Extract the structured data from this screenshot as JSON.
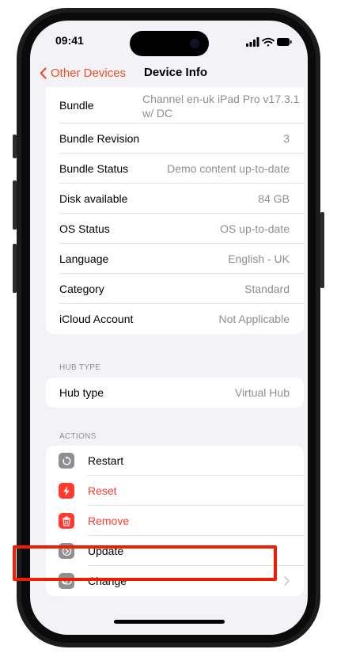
{
  "status": {
    "time": "09:41",
    "icons": [
      "signal-icon",
      "wifi-icon",
      "battery-icon"
    ]
  },
  "nav": {
    "back_label": "Other Devices",
    "title": "Device Info"
  },
  "info_rows": [
    {
      "label": "Bundle",
      "value": "Channel en-uk iPad Pro v17.3.1 w/ DC"
    },
    {
      "label": "Bundle Revision",
      "value": "3"
    },
    {
      "label": "Bundle Status",
      "value": "Demo content up-to-date"
    },
    {
      "label": "Disk available",
      "value": "84 GB"
    },
    {
      "label": "OS Status",
      "value": "OS up-to-date"
    },
    {
      "label": "Language",
      "value": "English - UK"
    },
    {
      "label": "Category",
      "value": "Standard"
    },
    {
      "label": "iCloud Account",
      "value": "Not Applicable"
    }
  ],
  "hub": {
    "header": "HUB TYPE",
    "row": {
      "label": "Hub type",
      "value": "Virtual Hub"
    }
  },
  "actions": {
    "header": "ACTIONS",
    "items": [
      {
        "label": "Restart",
        "icon": "restart-icon",
        "color": "#000000",
        "icon_bg": "#8e8e93"
      },
      {
        "label": "Reset",
        "icon": "bolt-icon",
        "color": "#ff3b30",
        "icon_bg": "#ff3b30"
      },
      {
        "label": "Remove",
        "icon": "trash-icon",
        "color": "#ff3b30",
        "icon_bg": "#ff3b30"
      },
      {
        "label": "Update",
        "icon": "update-icon",
        "color": "#000000",
        "icon_bg": "#8e8e93"
      },
      {
        "label": "Change",
        "icon": "toggle-icon",
        "color": "#000000",
        "icon_bg": "#8e8e93"
      }
    ]
  },
  "colors": {
    "accent": "#f04e23",
    "highlight": "#f01e00",
    "background": "#f2f2f7"
  }
}
